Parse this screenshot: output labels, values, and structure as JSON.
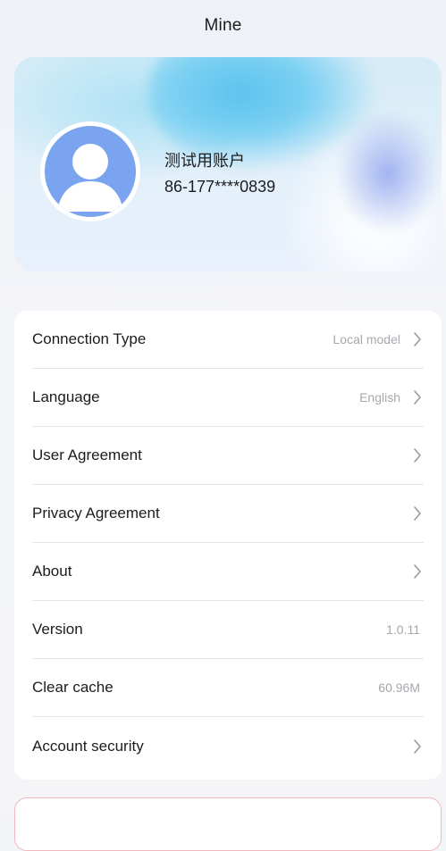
{
  "header": {
    "title": "Mine"
  },
  "profile": {
    "avatar_icon": "user-avatar-icon",
    "name": "测试用账户",
    "phone": "86-177****0839"
  },
  "settings": {
    "items": [
      {
        "label": "Connection Type",
        "value": "Local model",
        "has_chevron": true
      },
      {
        "label": "Language",
        "value": "English",
        "has_chevron": true
      },
      {
        "label": "User Agreement",
        "value": "",
        "has_chevron": true
      },
      {
        "label": "Privacy Agreement",
        "value": "",
        "has_chevron": true
      },
      {
        "label": "About",
        "value": "",
        "has_chevron": true
      },
      {
        "label": "Version",
        "value": "1.0.11",
        "has_chevron": false
      },
      {
        "label": "Clear cache",
        "value": "60.96M",
        "has_chevron": false
      },
      {
        "label": "Account security",
        "value": "",
        "has_chevron": true
      }
    ]
  },
  "colors": {
    "background": "#f3f4f8",
    "card": "#ffffff",
    "text_primary": "#1c1c1e",
    "text_secondary": "#a7a7ad",
    "avatar_blue": "#7aa3f0",
    "logout_border": "#f1b7bd"
  }
}
